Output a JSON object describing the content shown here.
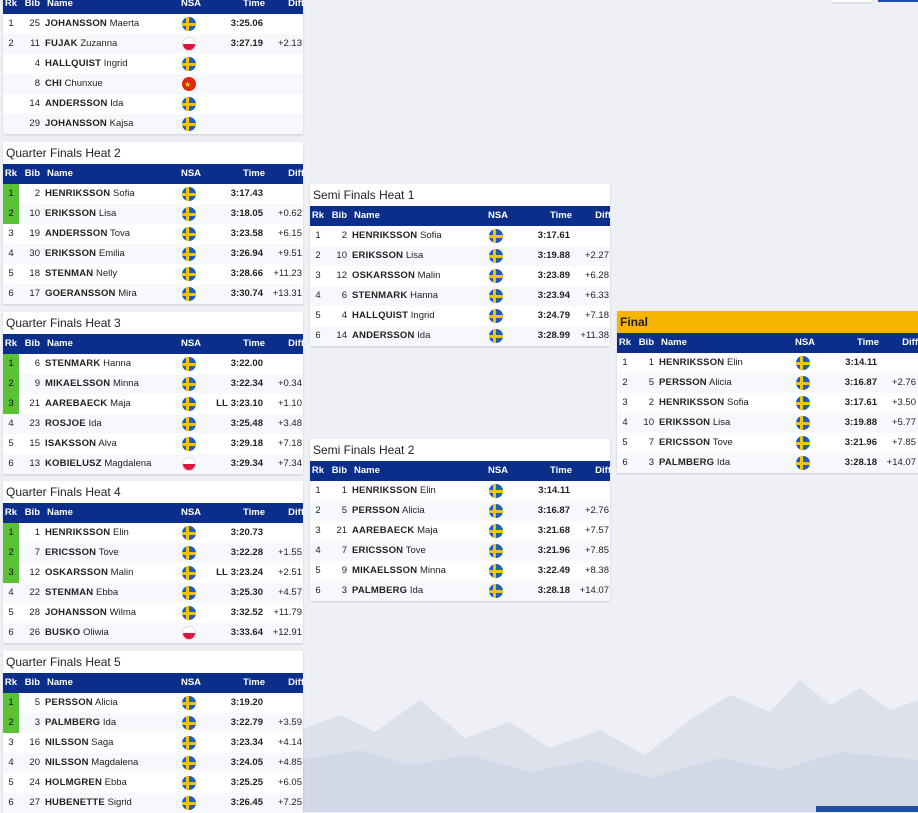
{
  "headers": {
    "rk": "Rk",
    "bib": "Bib",
    "name": "Name",
    "nsa": "NSA",
    "time": "Time",
    "diff": "Diff"
  },
  "panels": [
    {
      "id": "qf1",
      "title": "",
      "rows": [
        {
          "rk": "1",
          "bib": "25",
          "last": "JOHANSSON",
          "first": "Maerta",
          "nsa": "SWE",
          "time": "3:25.06",
          "ll": "",
          "diff": "",
          "q": false
        },
        {
          "rk": "2",
          "bib": "11",
          "last": "FUJAK",
          "first": "Zuzanna",
          "nsa": "POL",
          "time": "3:27.19",
          "ll": "",
          "diff": "+2.13",
          "q": false
        },
        {
          "rk": "",
          "bib": "4",
          "last": "HALLQUIST",
          "first": "Ingrid",
          "nsa": "SWE",
          "time": "",
          "ll": "",
          "diff": "",
          "q": false
        },
        {
          "rk": "",
          "bib": "8",
          "last": "CHI",
          "first": "Chunxue",
          "nsa": "CHN",
          "time": "",
          "ll": "",
          "diff": "",
          "q": false
        },
        {
          "rk": "",
          "bib": "14",
          "last": "ANDERSSON",
          "first": "Ida",
          "nsa": "SWE",
          "time": "",
          "ll": "",
          "diff": "",
          "q": false
        },
        {
          "rk": "",
          "bib": "29",
          "last": "JOHANSSON",
          "first": "Kajsa",
          "nsa": "SWE",
          "time": "",
          "ll": "",
          "diff": "",
          "q": false
        }
      ]
    },
    {
      "id": "qf2",
      "title": "Quarter Finals Heat 2",
      "rows": [
        {
          "rk": "1",
          "bib": "2",
          "last": "HENRIKSSON",
          "first": "Sofia",
          "nsa": "SWE",
          "time": "3:17.43",
          "ll": "",
          "diff": "",
          "q": true
        },
        {
          "rk": "2",
          "bib": "10",
          "last": "ERIKSSON",
          "first": "Lisa",
          "nsa": "SWE",
          "time": "3:18.05",
          "ll": "",
          "diff": "+0.62",
          "q": true
        },
        {
          "rk": "3",
          "bib": "19",
          "last": "ANDERSSON",
          "first": "Tova",
          "nsa": "SWE",
          "time": "3:23.58",
          "ll": "",
          "diff": "+6.15",
          "q": false
        },
        {
          "rk": "4",
          "bib": "30",
          "last": "ERIKSSON",
          "first": "Emilia",
          "nsa": "SWE",
          "time": "3:26.94",
          "ll": "",
          "diff": "+9.51",
          "q": false
        },
        {
          "rk": "5",
          "bib": "18",
          "last": "STENMAN",
          "first": "Nelly",
          "nsa": "SWE",
          "time": "3:28.66",
          "ll": "",
          "diff": "+11.23",
          "q": false
        },
        {
          "rk": "6",
          "bib": "17",
          "last": "GOERANSSON",
          "first": "Mira",
          "nsa": "SWE",
          "time": "3:30.74",
          "ll": "",
          "diff": "+13.31",
          "q": false
        }
      ]
    },
    {
      "id": "qf3",
      "title": "Quarter Finals Heat 3",
      "rows": [
        {
          "rk": "1",
          "bib": "6",
          "last": "STENMARK",
          "first": "Hanna",
          "nsa": "SWE",
          "time": "3:22.00",
          "ll": "",
          "diff": "",
          "q": true
        },
        {
          "rk": "2",
          "bib": "9",
          "last": "MIKAELSSON",
          "first": "Minna",
          "nsa": "SWE",
          "time": "3:22.34",
          "ll": "",
          "diff": "+0.34",
          "q": true
        },
        {
          "rk": "3",
          "bib": "21",
          "last": "AAREBAECK",
          "first": "Maja",
          "nsa": "SWE",
          "time": "3:23.10",
          "ll": "LL",
          "diff": "+1.10",
          "q": true
        },
        {
          "rk": "4",
          "bib": "23",
          "last": "ROSJOE",
          "first": "Ida",
          "nsa": "SWE",
          "time": "3:25.48",
          "ll": "",
          "diff": "+3.48",
          "q": false
        },
        {
          "rk": "5",
          "bib": "15",
          "last": "ISAKSSON",
          "first": "Alva",
          "nsa": "SWE",
          "time": "3:29.18",
          "ll": "",
          "diff": "+7.18",
          "q": false
        },
        {
          "rk": "6",
          "bib": "13",
          "last": "KOBIELUSZ",
          "first": "Magdalena",
          "nsa": "POL",
          "time": "3:29.34",
          "ll": "",
          "diff": "+7.34",
          "q": false
        }
      ]
    },
    {
      "id": "qf4",
      "title": "Quarter Finals Heat 4",
      "rows": [
        {
          "rk": "1",
          "bib": "1",
          "last": "HENRIKSSON",
          "first": "Elin",
          "nsa": "SWE",
          "time": "3:20.73",
          "ll": "",
          "diff": "",
          "q": true
        },
        {
          "rk": "2",
          "bib": "7",
          "last": "ERICSSON",
          "first": "Tove",
          "nsa": "SWE",
          "time": "3:22.28",
          "ll": "",
          "diff": "+1.55",
          "q": true
        },
        {
          "rk": "3",
          "bib": "12",
          "last": "OSKARSSON",
          "first": "Malin",
          "nsa": "SWE",
          "time": "3:23.24",
          "ll": "LL",
          "diff": "+2.51",
          "q": true
        },
        {
          "rk": "4",
          "bib": "22",
          "last": "STENMAN",
          "first": "Ebba",
          "nsa": "SWE",
          "time": "3:25.30",
          "ll": "",
          "diff": "+4.57",
          "q": false
        },
        {
          "rk": "5",
          "bib": "28",
          "last": "JOHANSSON",
          "first": "Wilma",
          "nsa": "SWE",
          "time": "3:32.52",
          "ll": "",
          "diff": "+11.79",
          "q": false
        },
        {
          "rk": "6",
          "bib": "26",
          "last": "BUSKO",
          "first": "Oliwia",
          "nsa": "POL",
          "time": "3:33.64",
          "ll": "",
          "diff": "+12.91",
          "q": false
        }
      ]
    },
    {
      "id": "qf5",
      "title": "Quarter Finals Heat 5",
      "rows": [
        {
          "rk": "1",
          "bib": "5",
          "last": "PERSSON",
          "first": "Alicia",
          "nsa": "SWE",
          "time": "3:19.20",
          "ll": "",
          "diff": "",
          "q": true
        },
        {
          "rk": "2",
          "bib": "3",
          "last": "PALMBERG",
          "first": "Ida",
          "nsa": "SWE",
          "time": "3:22.79",
          "ll": "",
          "diff": "+3.59",
          "q": true
        },
        {
          "rk": "3",
          "bib": "16",
          "last": "NILSSON",
          "first": "Saga",
          "nsa": "SWE",
          "time": "3:23.34",
          "ll": "",
          "diff": "+4.14",
          "q": false
        },
        {
          "rk": "4",
          "bib": "20",
          "last": "NILSSON",
          "first": "Magdalena",
          "nsa": "SWE",
          "time": "3:24.05",
          "ll": "",
          "diff": "+4.85",
          "q": false
        },
        {
          "rk": "5",
          "bib": "24",
          "last": "HOLMGREN",
          "first": "Ebba",
          "nsa": "SWE",
          "time": "3:25.25",
          "ll": "",
          "diff": "+6.05",
          "q": false
        },
        {
          "rk": "6",
          "bib": "27",
          "last": "HUBENETTE",
          "first": "Sigrid",
          "nsa": "SWE",
          "time": "3:26.45",
          "ll": "",
          "diff": "+7.25",
          "q": false
        }
      ]
    },
    {
      "id": "sf1",
      "title": "Semi Finals Heat 1",
      "rows": [
        {
          "rk": "1",
          "bib": "2",
          "last": "HENRIKSSON",
          "first": "Sofia",
          "nsa": "SWE",
          "time": "3:17.61",
          "ll": "",
          "diff": "",
          "q": false
        },
        {
          "rk": "2",
          "bib": "10",
          "last": "ERIKSSON",
          "first": "Lisa",
          "nsa": "SWE",
          "time": "3:19.88",
          "ll": "",
          "diff": "+2.27",
          "q": false
        },
        {
          "rk": "3",
          "bib": "12",
          "last": "OSKARSSON",
          "first": "Malin",
          "nsa": "SWE",
          "time": "3:23.89",
          "ll": "",
          "diff": "+6.28",
          "q": false
        },
        {
          "rk": "4",
          "bib": "6",
          "last": "STENMARK",
          "first": "Hanna",
          "nsa": "SWE",
          "time": "3:23.94",
          "ll": "",
          "diff": "+6.33",
          "q": false
        },
        {
          "rk": "5",
          "bib": "4",
          "last": "HALLQUIST",
          "first": "Ingrid",
          "nsa": "SWE",
          "time": "3:24.79",
          "ll": "",
          "diff": "+7.18",
          "q": false
        },
        {
          "rk": "6",
          "bib": "14",
          "last": "ANDERSSON",
          "first": "Ida",
          "nsa": "SWE",
          "time": "3:28.99",
          "ll": "",
          "diff": "+11.38",
          "q": false
        }
      ]
    },
    {
      "id": "sf2",
      "title": "Semi Finals Heat 2",
      "rows": [
        {
          "rk": "1",
          "bib": "1",
          "last": "HENRIKSSON",
          "first": "Elin",
          "nsa": "SWE",
          "time": "3:14.11",
          "ll": "",
          "diff": "",
          "q": false
        },
        {
          "rk": "2",
          "bib": "5",
          "last": "PERSSON",
          "first": "Alicia",
          "nsa": "SWE",
          "time": "3:16.87",
          "ll": "",
          "diff": "+2.76",
          "q": false
        },
        {
          "rk": "3",
          "bib": "21",
          "last": "AAREBAECK",
          "first": "Maja",
          "nsa": "SWE",
          "time": "3:21.68",
          "ll": "",
          "diff": "+7.57",
          "q": false
        },
        {
          "rk": "4",
          "bib": "7",
          "last": "ERICSSON",
          "first": "Tove",
          "nsa": "SWE",
          "time": "3:21.96",
          "ll": "",
          "diff": "+7.85",
          "q": false
        },
        {
          "rk": "5",
          "bib": "9",
          "last": "MIKAELSSON",
          "first": "Minna",
          "nsa": "SWE",
          "time": "3:22.49",
          "ll": "",
          "diff": "+8.38",
          "q": false
        },
        {
          "rk": "6",
          "bib": "3",
          "last": "PALMBERG",
          "first": "Ida",
          "nsa": "SWE",
          "time": "3:28.18",
          "ll": "",
          "diff": "+14.07",
          "q": false
        }
      ]
    },
    {
      "id": "final",
      "title": "Final",
      "rows": [
        {
          "rk": "1",
          "bib": "1",
          "last": "HENRIKSSON",
          "first": "Elin",
          "nsa": "SWE",
          "time": "3:14.11",
          "ll": "",
          "diff": "",
          "q": false
        },
        {
          "rk": "2",
          "bib": "5",
          "last": "PERSSON",
          "first": "Alicia",
          "nsa": "SWE",
          "time": "3:16.87",
          "ll": "",
          "diff": "+2.76",
          "q": false
        },
        {
          "rk": "3",
          "bib": "2",
          "last": "HENRIKSSON",
          "first": "Sofia",
          "nsa": "SWE",
          "time": "3:17.61",
          "ll": "",
          "diff": "+3.50",
          "q": false
        },
        {
          "rk": "4",
          "bib": "10",
          "last": "ERIKSSON",
          "first": "Lisa",
          "nsa": "SWE",
          "time": "3:19.88",
          "ll": "",
          "diff": "+5.77",
          "q": false
        },
        {
          "rk": "5",
          "bib": "7",
          "last": "ERICSSON",
          "first": "Tove",
          "nsa": "SWE",
          "time": "3:21.96",
          "ll": "",
          "diff": "+7.85",
          "q": false
        },
        {
          "rk": "6",
          "bib": "3",
          "last": "PALMBERG",
          "first": "Ida",
          "nsa": "SWE",
          "time": "3:28.18",
          "ll": "",
          "diff": "+14.07",
          "q": false
        }
      ]
    }
  ],
  "colors": {
    "header_bg": "#0b2e8a",
    "qualified": "#5bc236",
    "final_title": "#f7b500",
    "page_bg": "#eef0f6"
  }
}
